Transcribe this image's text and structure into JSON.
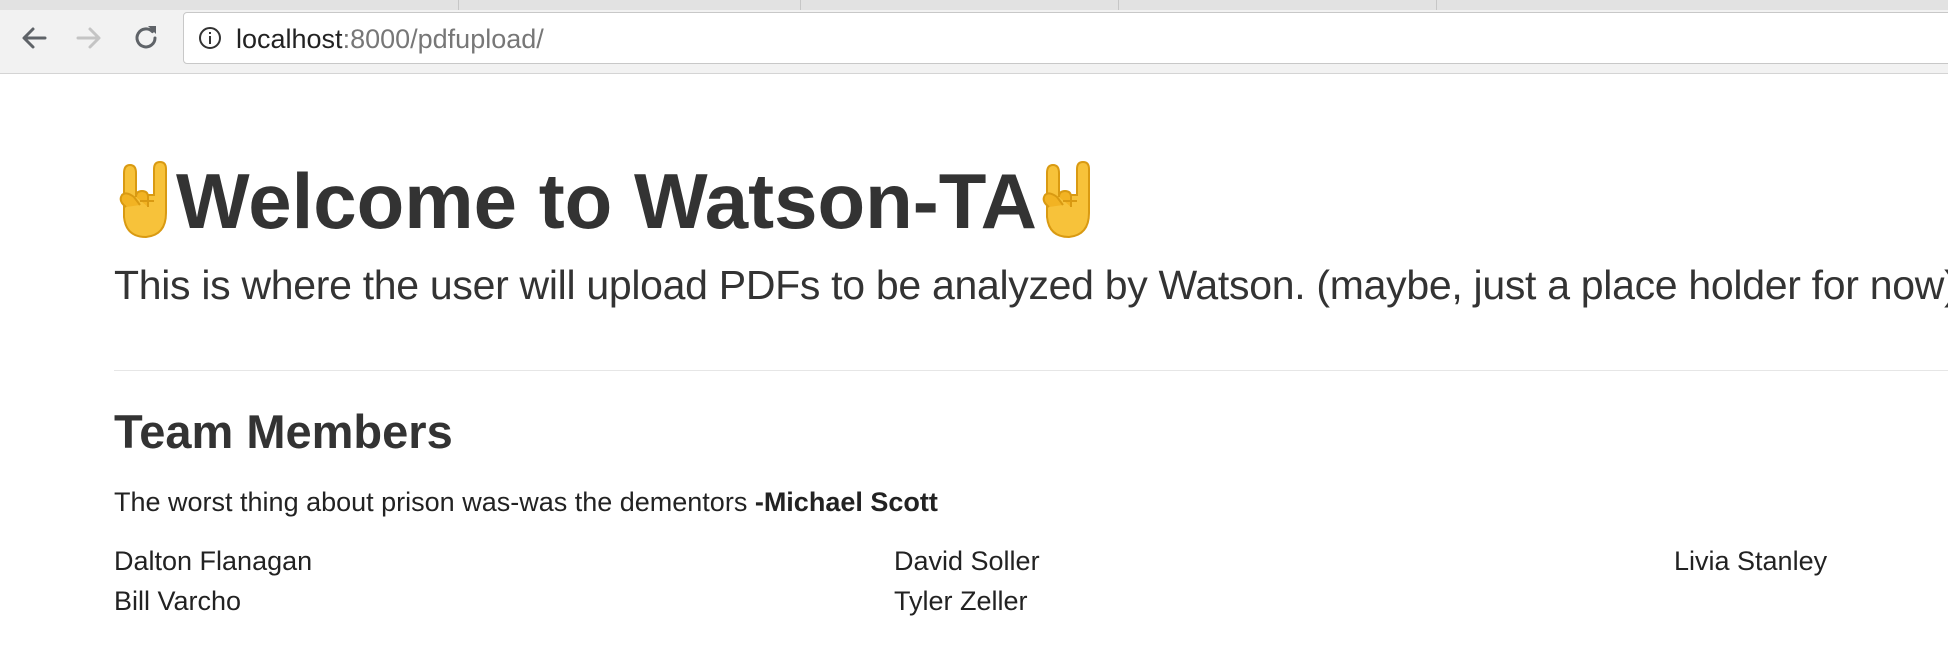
{
  "browser": {
    "url_host": "localhost",
    "url_rest": ":8000/pdfupload/",
    "icons": {
      "back": "back-arrow-icon",
      "forward": "forward-arrow-icon",
      "reload": "reload-icon",
      "site_info": "info-icon"
    }
  },
  "jumbotron": {
    "title": "Welcome to Watson-TA",
    "title_emoji": "sign-of-the-horns-emoji",
    "lead": "This is where the user will upload PDFs to be analyzed by Watson. (maybe, just a place holder for now)"
  },
  "team": {
    "heading": "Team Members",
    "quote_text": "The worst thing about prison was-was the dementors ",
    "quote_author": "-Michael Scott",
    "members": [
      "Dalton Flanagan",
      "David Soller",
      "Livia Stanley",
      "Bill Varcho",
      "Tyler Zeller"
    ]
  }
}
